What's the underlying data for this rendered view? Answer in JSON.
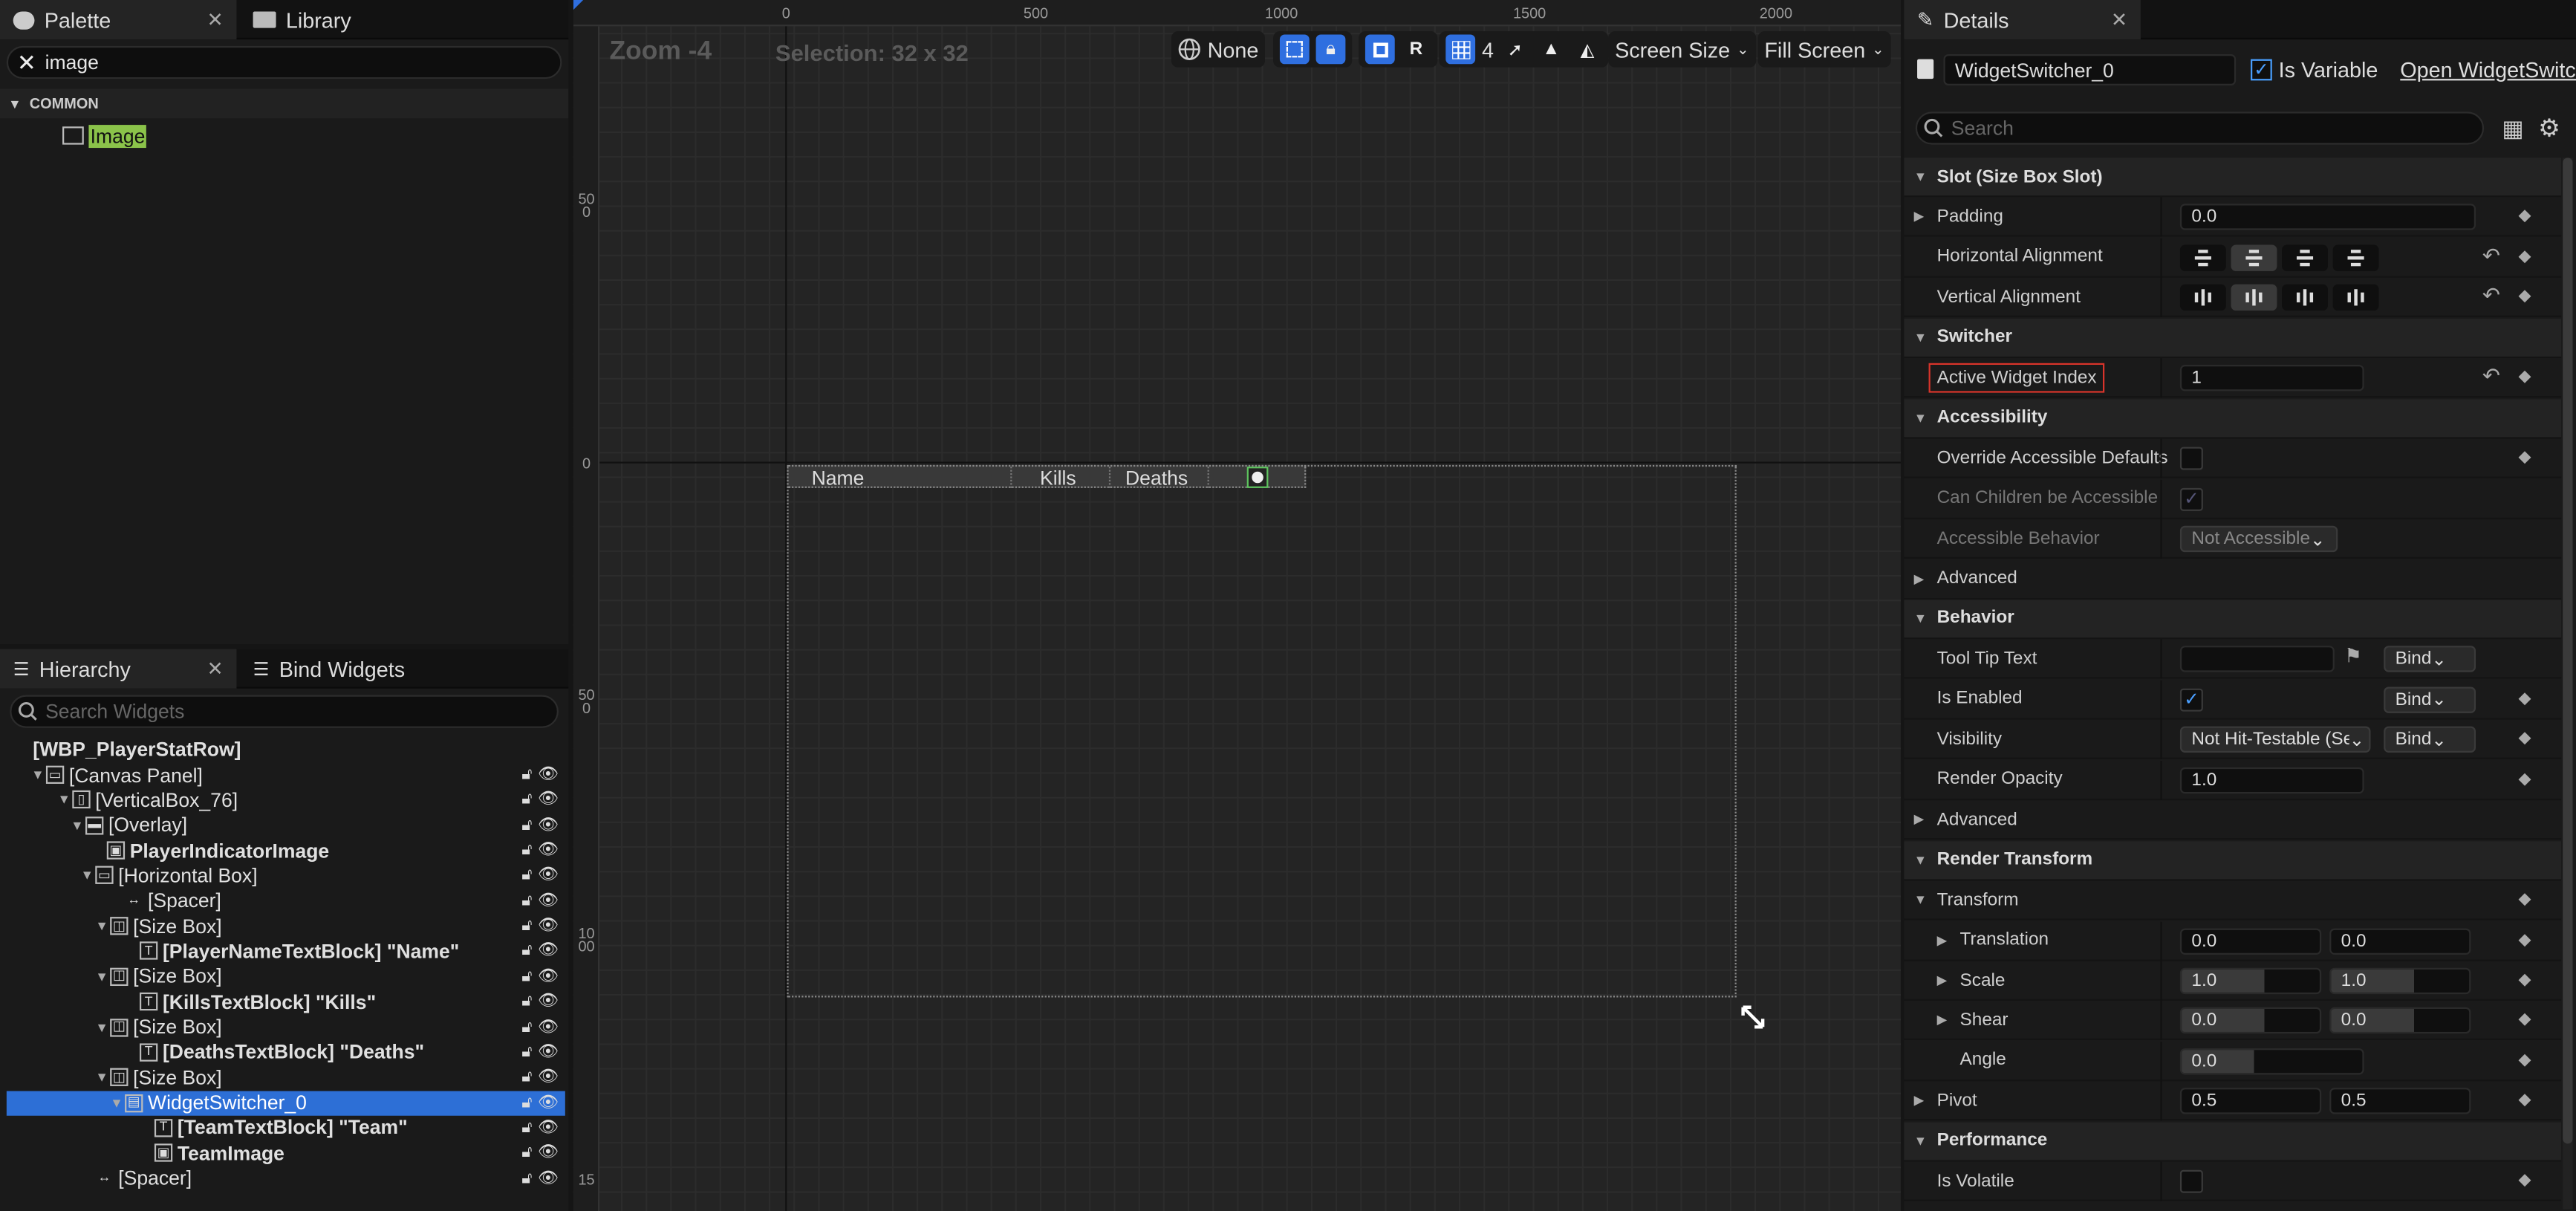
{
  "palette": {
    "tabs": [
      {
        "label": "Palette",
        "active": true
      },
      {
        "label": "Library",
        "active": false
      }
    ],
    "search_value": "image",
    "category": "COMMON",
    "items": [
      {
        "label": "Image",
        "highlight_color": "#8bc34a"
      }
    ]
  },
  "hierarchy": {
    "tabs": [
      {
        "label": "Hierarchy"
      },
      {
        "label": "Bind Widgets"
      }
    ],
    "search_placeholder": "Search Widgets",
    "root": "[WBP_PlayerStatRow]",
    "rows": [
      {
        "label": "[Canvas Panel]",
        "bold": false,
        "expanded": true,
        "icon": "canvas-panel-icon"
      },
      {
        "label": "[VerticalBox_76]",
        "bold": false,
        "expanded": true,
        "icon": "vertical-box-icon"
      },
      {
        "label": "[Overlay]",
        "bold": false,
        "expanded": true,
        "icon": "overlay-icon"
      },
      {
        "label": "PlayerIndicatorImage",
        "bold": true,
        "expanded": null,
        "icon": "image-icon"
      },
      {
        "label": "[Horizontal Box]",
        "bold": false,
        "expanded": true,
        "icon": "horizontal-box-icon"
      },
      {
        "label": "[Spacer]",
        "bold": false,
        "expanded": null,
        "icon": "spacer-icon"
      },
      {
        "label": "[Size Box]",
        "bold": false,
        "expanded": true,
        "icon": "size-box-icon"
      },
      {
        "label": "[PlayerNameTextBlock] \"Name\"",
        "bold": true,
        "expanded": null,
        "icon": "text-block-icon"
      },
      {
        "label": "[Size Box]",
        "bold": false,
        "expanded": true,
        "icon": "size-box-icon"
      },
      {
        "label": "[KillsTextBlock] \"Kills\"",
        "bold": true,
        "expanded": null,
        "icon": "text-block-icon"
      },
      {
        "label": "[Size Box]",
        "bold": false,
        "expanded": true,
        "icon": "size-box-icon"
      },
      {
        "label": "[DeathsTextBlock] \"Deaths\"",
        "bold": true,
        "expanded": null,
        "icon": "text-block-icon"
      },
      {
        "label": "[Size Box]",
        "bold": false,
        "expanded": true,
        "icon": "size-box-icon"
      },
      {
        "label": "WidgetSwitcher_0",
        "bold": false,
        "expanded": true,
        "icon": "widget-switcher-icon",
        "selected": true
      },
      {
        "label": "[TeamTextBlock] \"Team\"",
        "bold": true,
        "expanded": null,
        "icon": "text-block-icon"
      },
      {
        "label": "TeamImage",
        "bold": true,
        "expanded": null,
        "icon": "image-icon"
      },
      {
        "label": "[Spacer]",
        "bold": false,
        "expanded": null,
        "icon": "spacer-icon"
      }
    ]
  },
  "viewport": {
    "zoom": "Zoom -4",
    "selection": "Selection: 32 x 32",
    "ruler_top": [
      "0",
      "500",
      "1000",
      "1500",
      "2000"
    ],
    "ruler_left": [
      "500",
      "0",
      "500",
      "1000",
      "15"
    ],
    "toolbar": {
      "none_label": "None",
      "r_label": "R",
      "grid_value": "4",
      "screen_size": "Screen Size",
      "fill_screen": "Fill Screen"
    },
    "preview_row": {
      "name": "Name",
      "kills": "Kills",
      "deaths": "Deaths"
    }
  },
  "details": {
    "title": "Details",
    "widget_name": "WidgetSwitcher_0",
    "is_variable_label": "Is Variable",
    "is_variable": true,
    "open_label": "Open WidgetSwitch",
    "search_placeholder": "Search",
    "sections": {
      "slot": "Slot (Size Box Slot)",
      "switcher": "Switcher",
      "accessibility": "Accessibility",
      "advanced1": "Advanced",
      "behavior": "Behavior",
      "advanced2": "Advanced",
      "render_transform": "Render Transform",
      "transform": "Transform",
      "performance": "Performance"
    },
    "props": {
      "padding": {
        "label": "Padding",
        "value": "0.0"
      },
      "halign": {
        "label": "Horizontal Alignment"
      },
      "valign": {
        "label": "Vertical Alignment"
      },
      "active_widget_index": {
        "label": "Active Widget Index",
        "value": "1",
        "highlight_color": "#d9342b"
      },
      "override_accessible": {
        "label": "Override Accessible Defaults",
        "checked": false
      },
      "can_children": {
        "label": "Can Children be Accessible",
        "checked": true
      },
      "accessible_behavior": {
        "label": "Accessible Behavior",
        "value": "Not Accessible"
      },
      "tooltip": {
        "label": "Tool Tip Text",
        "value": "",
        "bind": "Bind"
      },
      "is_enabled": {
        "label": "Is Enabled",
        "checked": true,
        "bind": "Bind"
      },
      "visibility": {
        "label": "Visibility",
        "value": "Not Hit-Testable (Se",
        "bind": "Bind"
      },
      "render_opacity": {
        "label": "Render Opacity",
        "value": "1.0"
      },
      "translation": {
        "label": "Translation",
        "x": "0.0",
        "y": "0.0"
      },
      "scale": {
        "label": "Scale",
        "x": "1.0",
        "y": "1.0"
      },
      "shear": {
        "label": "Shear",
        "x": "0.0",
        "y": "0.0"
      },
      "angle": {
        "label": "Angle",
        "value": "0.0"
      },
      "pivot": {
        "label": "Pivot",
        "x": "0.5",
        "y": "0.5"
      },
      "is_volatile": {
        "label": "Is Volatile",
        "checked": false
      }
    }
  }
}
